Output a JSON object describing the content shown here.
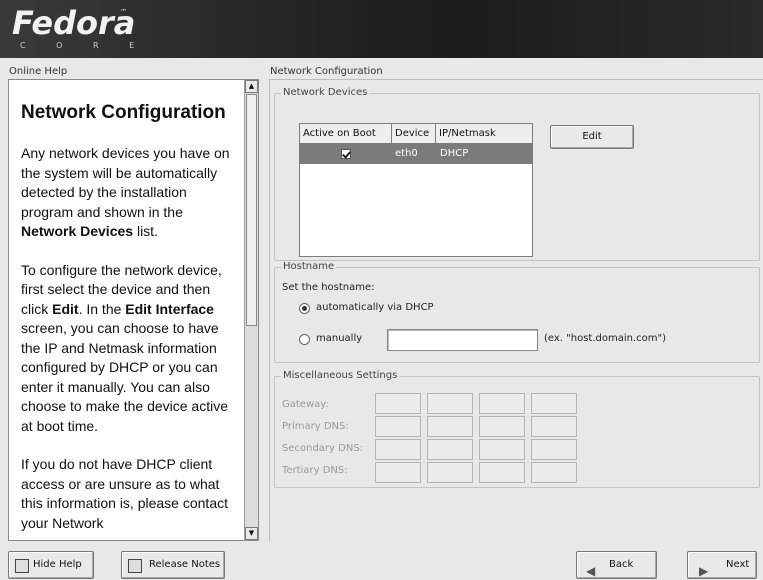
{
  "banner": {
    "brand": "Fedora",
    "sub": "C O R E",
    "tm": "™"
  },
  "help": {
    "caption": "Online Help",
    "title": "Network Configuration",
    "p1_a": "Any network devices you have on the system will be automatically detected by the installation program and shown in the ",
    "p1_b": "Network Devices",
    "p1_c": " list.",
    "p2_a": "To configure the network device, first select the device and then click ",
    "p2_b": "Edit",
    "p2_c": ". In the ",
    "p2_d": "Edit Interface",
    "p2_e": " screen, you can choose to have the IP and Netmask information configured by DHCP or you can enter it manually. You can also choose to make the device active at boot time.",
    "p3": "If you do not have DHCP client access or are unsure as to what this information is, please contact your Network"
  },
  "network": {
    "caption": "Network Configuration",
    "devices": {
      "label": "Network Devices",
      "columns": [
        "Active on Boot",
        "Device",
        "IP/Netmask"
      ],
      "rows": [
        {
          "active": true,
          "device": "eth0",
          "ip": "DHCP"
        }
      ],
      "edit_button": "Edit"
    },
    "hostname": {
      "label": "Hostname",
      "prompt": "Set the hostname:",
      "auto_option": "automatically via DHCP",
      "manual_option": "manually",
      "manual_value": "",
      "example": "(ex. \"host.domain.com\")",
      "selected": "auto"
    },
    "misc": {
      "label": "Miscellaneous Settings",
      "fields": [
        "Gateway:",
        "Primary DNS:",
        "Secondary DNS:",
        "Tertiary DNS:"
      ]
    }
  },
  "bottom": {
    "hide_help": "Hide Help",
    "release_notes": "Release Notes",
    "back": "Back",
    "next": "Next"
  }
}
